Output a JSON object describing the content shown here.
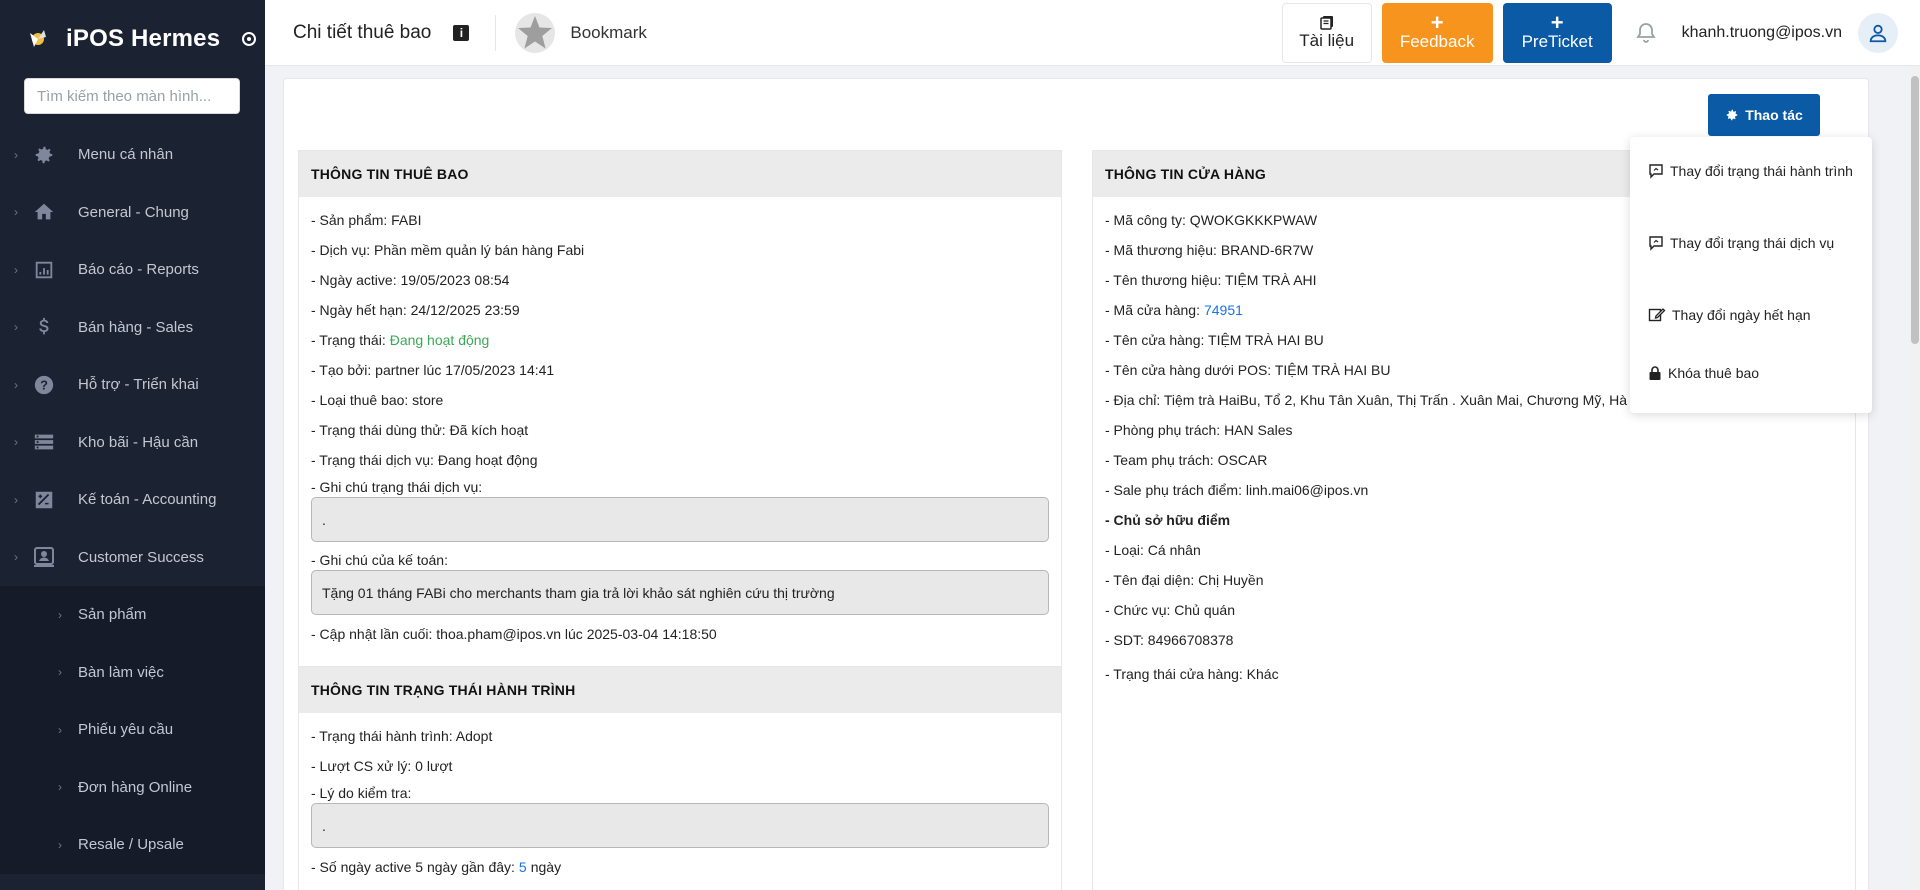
{
  "sidebar": {
    "brand": "iPOS Hermes",
    "search_placeholder": "Tìm kiếm theo màn hình...",
    "items": [
      {
        "label": "Menu cá nhân",
        "icon": "gear-icon"
      },
      {
        "label": "General - Chung",
        "icon": "home-icon"
      },
      {
        "label": "Báo cáo - Reports",
        "icon": "chart-icon"
      },
      {
        "label": "Bán hàng - Sales",
        "icon": "dollar-icon"
      },
      {
        "label": "Hỗ trợ - Triển khai",
        "icon": "help-icon"
      },
      {
        "label": "Kho bãi - Hậu cần",
        "icon": "warehouse-icon"
      },
      {
        "label": "Kế toán - Accounting",
        "icon": "accounting-icon"
      },
      {
        "label": "Customer Success",
        "icon": "customer-icon"
      }
    ],
    "sub_items": [
      {
        "label": "Sản phẩm"
      },
      {
        "label": "Bàn làm việc"
      },
      {
        "label": "Phiếu yêu cầu"
      },
      {
        "label": "Đơn hàng Online"
      },
      {
        "label": "Resale / Upsale"
      }
    ]
  },
  "header": {
    "title": "Chi tiết thuê bao",
    "bookmark": "Bookmark",
    "docs_label": "Tài liệu",
    "feedback_label": "Feedback",
    "preticket_label": "PreTicket",
    "plus": "+",
    "user_email": "khanh.truong@ipos.vn"
  },
  "actions": {
    "button_label": "Thao tác",
    "menu": [
      {
        "label": "Thay đổi trạng thái hành trình",
        "icon": "comment-edit-icon"
      },
      {
        "label": "Thay đổi trạng thái dịch vụ",
        "icon": "comment-edit-icon"
      },
      {
        "label": "Thay đổi ngày hết hạn",
        "icon": "edit-icon"
      },
      {
        "label": "Khóa thuê bao",
        "icon": "lock-icon"
      }
    ]
  },
  "subscription": {
    "heading": "THÔNG TIN THUÊ BAO",
    "product": "- Sản phẩm: FABI",
    "service": "- Dịch vụ: Phần mềm quản lý bán hàng Fabi",
    "active_date": "- Ngày active: 19/05/2023 08:54",
    "expiry_date": "- Ngày hết hạn: 24/12/2025 23:59",
    "status_label": "- Trạng thái:",
    "status_value": "Đang hoạt động",
    "created_by": "- Tạo bởi: partner lúc 17/05/2023 14:41",
    "type": "- Loại thuê bao: store",
    "trial_status": "- Trạng thái dùng thử: Đã kích hoạt",
    "service_status": "- Trạng thái dịch vụ: Đang hoạt động",
    "service_note_label": "- Ghi chú trạng thái dịch vụ:",
    "service_note_value": ".",
    "accounting_note_label": "- Ghi chú của kế toán:",
    "accounting_note_value": "Tặng 01 tháng FABi cho merchants tham gia trả lời khảo sát nghiên cứu thị trường",
    "last_update": "- Cập nhật lần cuối: thoa.pham@ipos.vn lúc 2025-03-04 14:18:50"
  },
  "journey": {
    "heading": "THÔNG TIN TRẠNG THÁI HÀNH TRÌNH",
    "status": "- Trạng thái hành trình: Adopt",
    "cs_count": "- Lượt CS xử lý: 0 lượt",
    "reason_label": "- Lý do kiểm tra:",
    "reason_value": ".",
    "active_days_label": "- Số ngày active 5 ngày gần đây:",
    "active_days_value": "5",
    "active_days_unit": "ngày"
  },
  "store": {
    "heading": "THÔNG TIN CỬA HÀNG",
    "company_code": "- Mã công ty: QWOKGKKKPWAW",
    "brand_code": "- Mã thương hiệu: BRAND-6R7W",
    "brand_name": "- Tên thương hiệu: TIỆM TRÀ AHI",
    "store_code_label": "- Mã cửa hàng:",
    "store_code_value": "74951",
    "store_name": "- Tên cửa hàng: TIỆM TRÀ HAI BU",
    "pos_store_name": "- Tên cửa hàng dưới POS: TIỆM TRÀ HAI BU",
    "address": "- Địa chỉ: Tiệm trà HaiBu, Tổ 2, Khu Tân Xuân, Thị Trấn . Xuân Mai, Chương Mỹ, Hà N",
    "department": "- Phòng phụ trách: HAN Sales",
    "team": "- Team phụ trách: OSCAR",
    "sale": "- Sale phụ trách điểm: linh.mai06@ipos.vn",
    "owner_heading": "- Chủ sở hữu điểm",
    "owner_type": "- Loại: Cá nhân",
    "representative": "- Tên đại diện: Chị Huyền",
    "position": "- Chức vụ: Chủ quán",
    "phone": "- SDT: 84966708378",
    "store_status": "- Trạng thái cửa hàng: Khác"
  },
  "colors": {
    "sidebar_bg": "#1b2232",
    "primary": "#0b5aa6",
    "feedback": "#f7941d",
    "active_green": "#3aa856",
    "link_blue": "#1a73e8"
  }
}
